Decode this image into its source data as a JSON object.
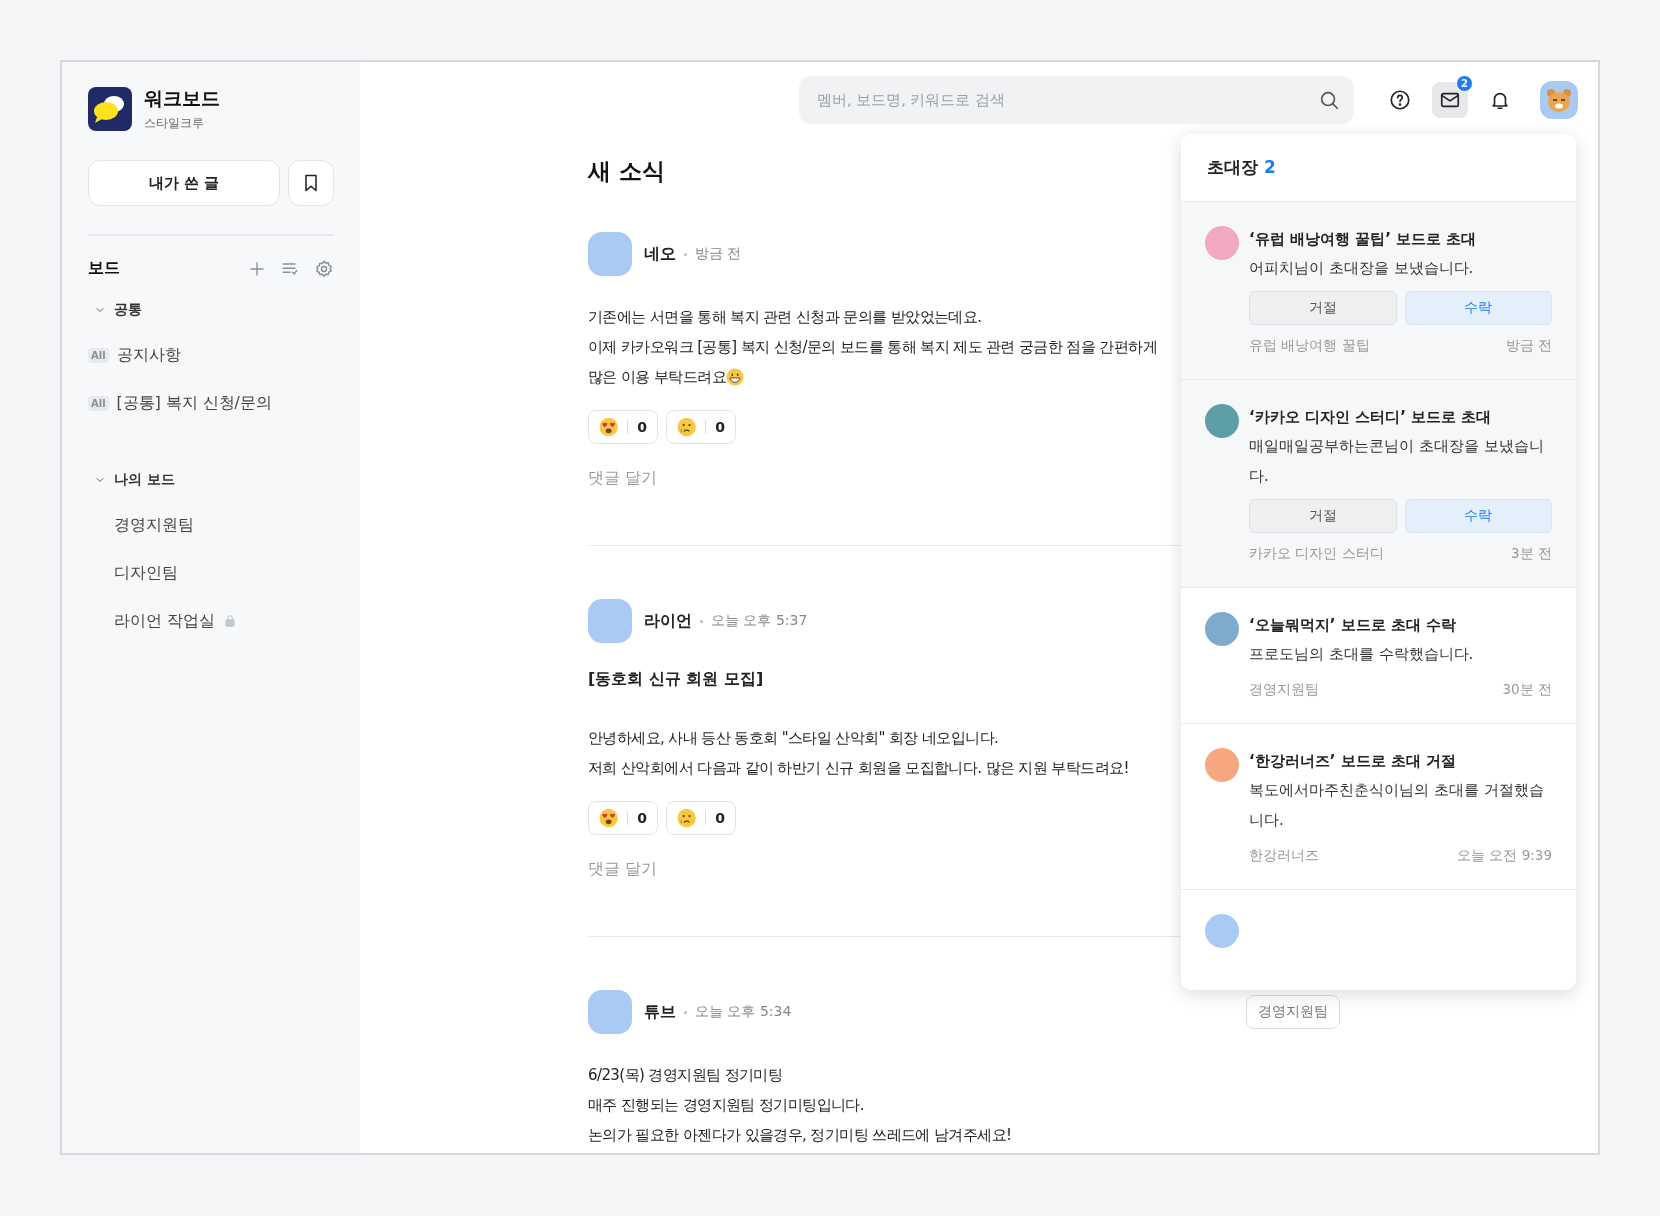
{
  "sidebar": {
    "logo_title": "워크보드",
    "logo_subtitle": "스타일크루",
    "my_posts_button": "내가 쓴 글",
    "boards_heading": "보드",
    "groups": [
      {
        "label": "공통",
        "expanded": true,
        "items": [
          {
            "badge": "All",
            "label": "공지사항",
            "locked": false
          },
          {
            "badge": "All",
            "label": "[공통] 복지 신청/문의",
            "locked": false
          }
        ]
      },
      {
        "label": "나의 보드",
        "expanded": true,
        "items": [
          {
            "label": "경영지원팀",
            "locked": false
          },
          {
            "label": "디자인팀",
            "locked": false
          },
          {
            "label": "라이언 작업실",
            "locked": true
          }
        ]
      }
    ]
  },
  "topbar": {
    "search": {
      "placeholder": "멤버, 보드명, 키워드로 검색"
    },
    "mail_badge": "2",
    "mail_selected": true
  },
  "feed": {
    "title": "새 소식",
    "posts": [
      {
        "author": "네오",
        "time": "방금 전",
        "lines": [
          "기존에는 서면을 통해 복지 관련 신청과 문의를 받았었는데요.",
          "이제 카카오워크 [공통] 복지 신청/문의 보드를 통해 복지 제도 관련 궁금한 점을 간편하게",
          "많은 이용 부탁드려요"
        ],
        "emoji_after": true,
        "reactions": [
          {
            "kind": "heart-eyes",
            "count": "0"
          },
          {
            "kind": "crying",
            "count": "0"
          }
        ],
        "comment": "댓글 달기"
      },
      {
        "author": "라이언",
        "time": "오늘 오후 5:37",
        "title": "[동호회 신규 회원 모집]",
        "lines": [
          "안녕하세요, 사내 등산 동호회 \"스타일 산악회\" 회장 네오입니다.",
          "저희 산악회에서 다음과 같이 하반기 신규 회원을 모집합니다. 많은 지원 부탁드려요!"
        ],
        "reactions": [
          {
            "kind": "heart-eyes",
            "count": "0"
          },
          {
            "kind": "crying",
            "count": "0"
          }
        ],
        "comment": "댓글 달기"
      },
      {
        "author": "튜브",
        "time": "오늘 오후 5:34",
        "tag": "경영지원팀",
        "lines": [
          "6/23(목) 경영지원팀 정기미팅",
          "매주 진행되는 경영지원팀 정기미팅입니다.",
          "논의가 필요한 아젠다가 있을경우, 정기미팅 쓰레드에 남겨주세요!"
        ]
      }
    ]
  },
  "invitations": {
    "title": "초대장",
    "count": "2",
    "items": [
      {
        "kind": "pending",
        "color": "#f2a7c3",
        "title": "‘유럽 배낭여행 꿀팁’ 보드로 초대",
        "message": "어피치님이 초대장을 보냈습니다.",
        "decline": "거절",
        "accept": "수락",
        "board": "유럽 배낭여행 꿀팁",
        "time": "방금 전"
      },
      {
        "kind": "pending",
        "color": "#5e9ea6",
        "title": "‘카카오 디자인 스터디’ 보드로 초대",
        "message": "매일매일공부하는콘님이 초대장을 보냈습니다.",
        "decline": "거절",
        "accept": "수락",
        "board": "카카오 디자인 스터디",
        "time": "3분 전"
      },
      {
        "kind": "result",
        "color": "#7eaacb",
        "title": "‘오늘뭐먹지’ 보드로 초대 수락",
        "message": "프로도님의 초대를 수락했습니다.",
        "board": "경영지원팀",
        "time": "30분 전"
      },
      {
        "kind": "result",
        "color": "#f7a77f",
        "title": "‘한강러너즈’ 보드로 초대 거절",
        "message": "복도에서마주친춘식이님의 초대를 거절했습니다.",
        "board": "한강러너즈",
        "time": "오늘 오전 9:39"
      },
      {
        "kind": "cut",
        "color": "#a9cbf3"
      }
    ]
  }
}
